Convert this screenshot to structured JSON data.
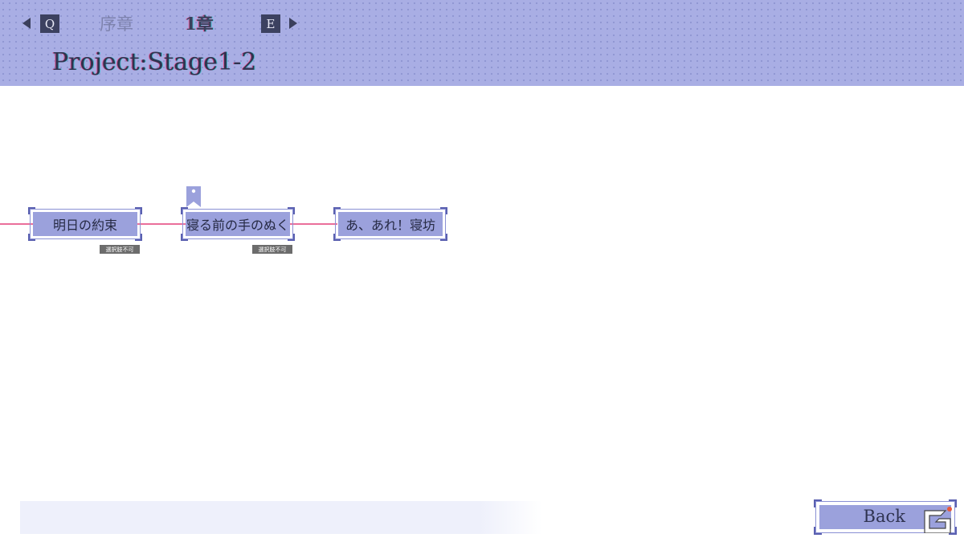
{
  "header": {
    "prev_key": "Q",
    "next_key": "E",
    "chapter_tabs": [
      {
        "label": "序章"
      },
      {
        "label": "1章"
      }
    ],
    "project_title": "Project:Stage1-2"
  },
  "flow": {
    "line_color": "#ea6f9a",
    "nodes": [
      {
        "label": "明日の約束",
        "badge": "選択肢不可"
      },
      {
        "label": "寝る前の手のぬく",
        "badge": "選択肢不可",
        "bookmarked": true
      },
      {
        "label": "あ、あれ！寝坊"
      }
    ]
  },
  "footer": {
    "back_label": "Back"
  },
  "colors": {
    "header_bg": "#a9aee4",
    "node_fill": "#9ba1dc",
    "accent_line": "#ea6f9a"
  }
}
